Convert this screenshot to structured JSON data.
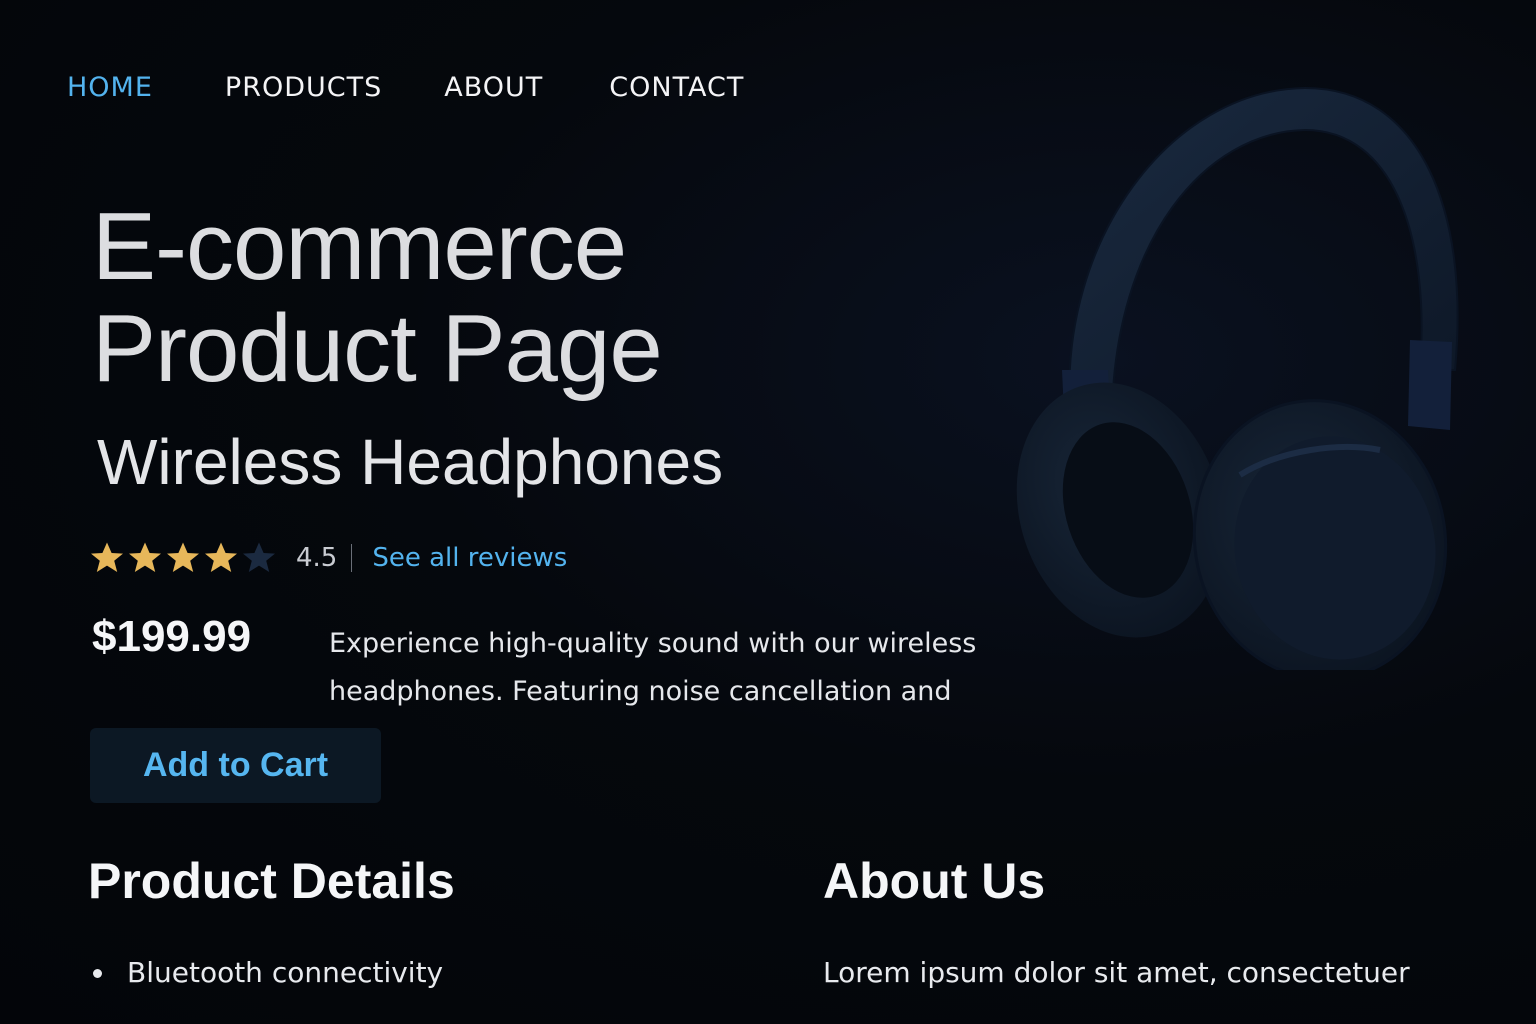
{
  "nav": {
    "items": [
      {
        "label": "HOME",
        "active": true
      },
      {
        "label": "PRODUCTS",
        "active": false
      },
      {
        "label": "ABOUT",
        "active": false
      },
      {
        "label": "CONTACT",
        "active": false
      }
    ]
  },
  "hero": {
    "title_line1": "E-commerce",
    "title_line2": "Product Page",
    "product_name": "Wireless Headphones",
    "image_icon": "headphones-icon"
  },
  "rating": {
    "value": "4.5",
    "stars_filled": 4,
    "stars_total": 5,
    "reviews_link": "See all reviews"
  },
  "price": "$199.99",
  "description": "Experience high-quality sound with our wireless headphones. Featuring noise cancellation and",
  "cart_button": "Add to Cart",
  "product_details": {
    "title": "Product Details",
    "items": [
      "Bluetooth connectivity"
    ]
  },
  "about": {
    "title": "About Us",
    "text": "Lorem ipsum dolor sit amet, consectetuer"
  },
  "colors": {
    "accent": "#53b3ee",
    "background": "#04060a",
    "star_filled": "#e7b75a",
    "star_empty": "#1b2a40",
    "button_bg": "#0c1824"
  }
}
